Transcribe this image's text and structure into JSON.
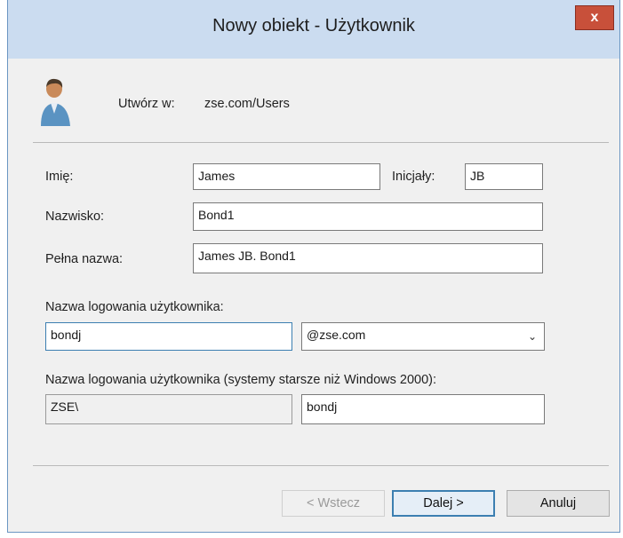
{
  "window": {
    "title": "Nowy obiekt - Użytkownik",
    "close_glyph": "x"
  },
  "create_in": {
    "label": "Utwórz w:",
    "value": "zse.com/Users"
  },
  "fields": {
    "first_name": {
      "label": "Imię:",
      "value": "James"
    },
    "initials": {
      "label": "Inicjały:",
      "value": "JB"
    },
    "last_name": {
      "label": "Nazwisko:",
      "value": "Bond1"
    },
    "full_name": {
      "label": "Pełna nazwa:",
      "value": "James JB. Bond1"
    },
    "logon_name": {
      "label": "Nazwa logowania użytkownika:",
      "value": "bondj"
    },
    "domain_suffix": {
      "value": "@zse.com"
    },
    "legacy_logon": {
      "label": "Nazwa logowania użytkownika (systemy starsze niż Windows 2000):",
      "domain": "ZSE\\",
      "value": "bondj"
    }
  },
  "buttons": {
    "back": "< Wstecz",
    "next": "Dalej >",
    "cancel": "Anuluj"
  },
  "icons": {
    "user": "user-icon",
    "close": "close-icon",
    "dropdown": "chevron-down-icon"
  }
}
